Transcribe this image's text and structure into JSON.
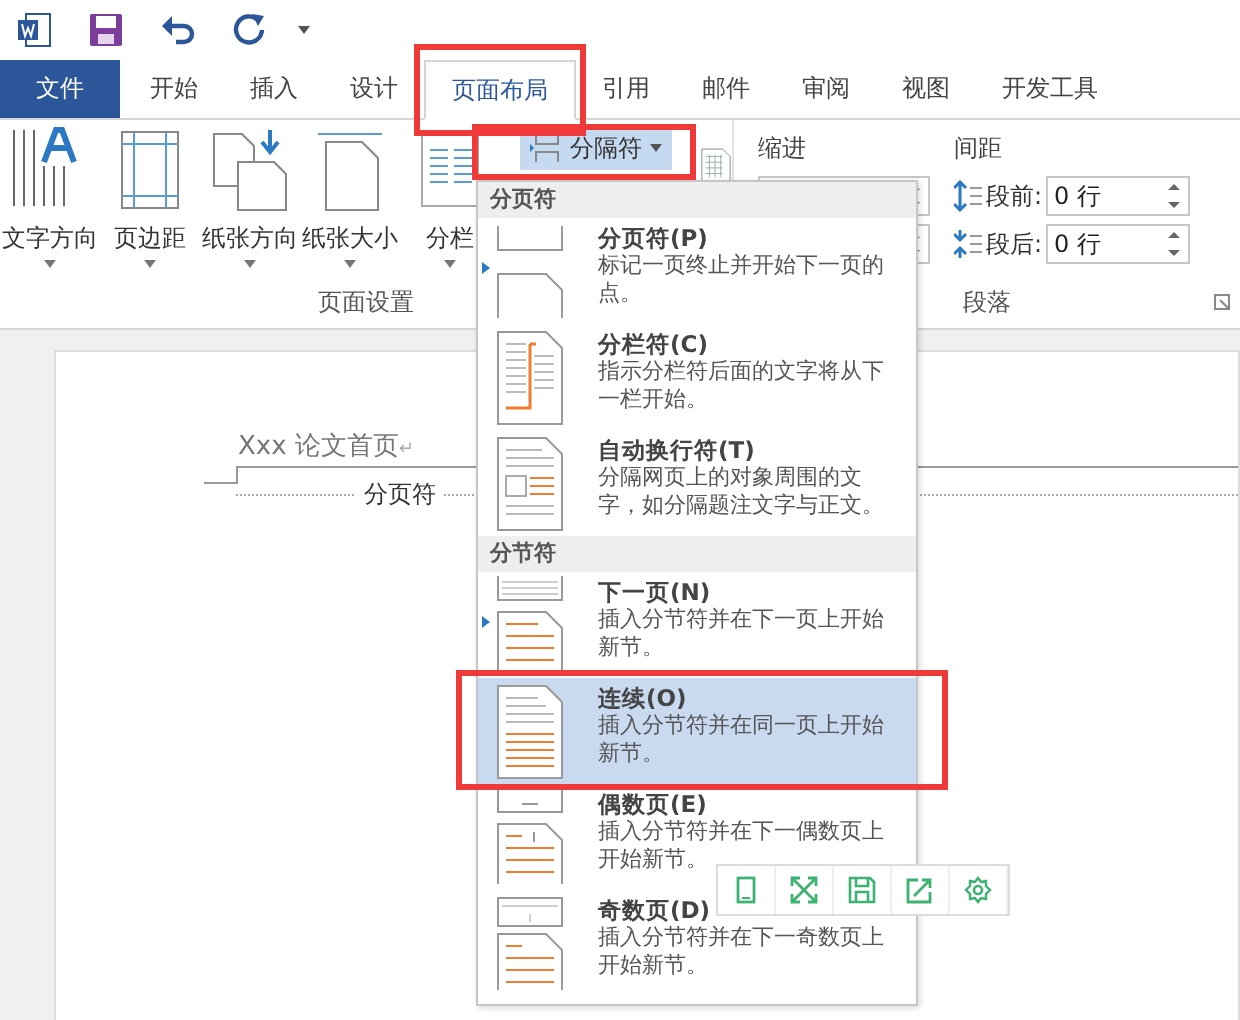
{
  "tabs": [
    {
      "label": "文件",
      "kind": "file",
      "selected": false
    },
    {
      "label": "开始",
      "kind": "tab",
      "selected": false
    },
    {
      "label": "插入",
      "kind": "tab",
      "selected": false
    },
    {
      "label": "设计",
      "kind": "tab",
      "selected": false
    },
    {
      "label": "页面布局",
      "kind": "tab",
      "selected": true
    },
    {
      "label": "引用",
      "kind": "tab",
      "selected": false
    },
    {
      "label": "邮件",
      "kind": "tab",
      "selected": false
    },
    {
      "label": "审阅",
      "kind": "tab",
      "selected": false
    },
    {
      "label": "视图",
      "kind": "tab",
      "selected": false
    },
    {
      "label": "开发工具",
      "kind": "tab",
      "selected": false
    }
  ],
  "page_setup": {
    "buttons": [
      {
        "label": "文字方向",
        "kind": "direction"
      },
      {
        "label": "页边距",
        "kind": "margins"
      },
      {
        "label": "纸张方向",
        "kind": "orientation"
      },
      {
        "label": "纸张大小",
        "kind": "size"
      },
      {
        "label": "分栏",
        "kind": "columns"
      }
    ],
    "breaks_button": {
      "label": "分隔符",
      "expanded": true
    },
    "group_label": "页面设置"
  },
  "paragraph": {
    "indent_label": "缩进",
    "spacing_label": "间距",
    "spacing": [
      {
        "label": "段前:",
        "value": "0 行",
        "kind": "before"
      },
      {
        "label": "段后:",
        "value": "0 行",
        "kind": "after"
      }
    ],
    "group_label": "段落"
  },
  "document": {
    "header_text": "Xxx 论文首页",
    "paragraph_mark": "↵",
    "break_label": "分页符"
  },
  "menu": {
    "sections": [
      {
        "title": "分页符",
        "items": [
          {
            "title": "分页符(P)",
            "description": "标记一页终止并开始下一页的点。",
            "kind": "page",
            "selected": false
          },
          {
            "title": "分栏符(C)",
            "description": "指示分栏符后面的文字将从下一栏开始。",
            "kind": "column",
            "selected": false
          },
          {
            "title": "自动换行符(T)",
            "description": "分隔网页上的对象周围的文字，如分隔题注文字与正文。",
            "kind": "wrap",
            "selected": false
          }
        ]
      },
      {
        "title": "分节符",
        "items": [
          {
            "title": "下一页(N)",
            "description": "插入分节符并在下一页上开始新节。",
            "kind": "next",
            "selected": false
          },
          {
            "title": "连续(O)",
            "description": "插入分节符并在同一页上开始新节。",
            "kind": "continuous",
            "selected": true
          },
          {
            "title": "偶数页(E)",
            "description": "插入分节符并在下一偶数页上开始新节。",
            "kind": "even",
            "selected": false
          },
          {
            "title": "奇数页(D)",
            "description": "插入分节符并在下一奇数页上开始新节。",
            "kind": "odd",
            "selected": false
          }
        ]
      }
    ]
  }
}
